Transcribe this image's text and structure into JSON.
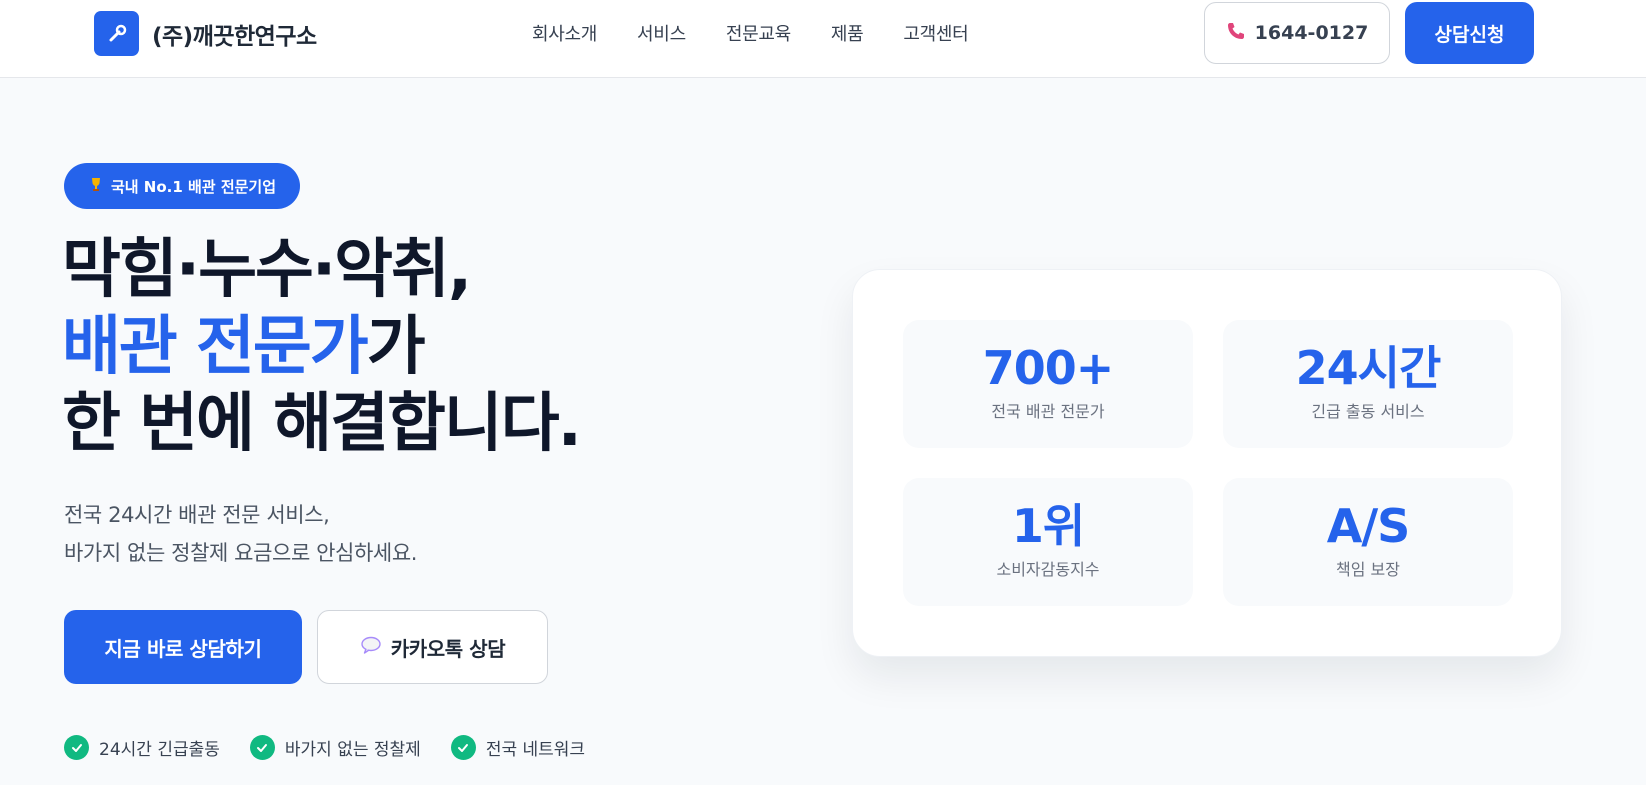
{
  "header": {
    "logo_text": "(주)깨끗한연구소",
    "nav": [
      "회사소개",
      "서비스",
      "전문교육",
      "제품",
      "고객센터"
    ],
    "phone": "1644-0127",
    "consult_label": "상담신청"
  },
  "hero": {
    "badge": "국내 No.1 배관 전문기업",
    "headline_line1": "막힘·누수·악취,",
    "headline_accent": "배관 전문가",
    "headline_line2_rest": "가",
    "headline_line3": "한 번에 해결합니다.",
    "sub_line1": "전국 24시간 배관 전문 서비스,",
    "sub_line2": "바가지 없는 정찰제 요금으로 안심하세요.",
    "cta_primary": "지금 바로 상담하기",
    "cta_secondary": "카카오톡 상담",
    "features": [
      "24시간 긴급출동",
      "바가지 없는 정찰제",
      "전국 네트워크"
    ]
  },
  "stats": [
    {
      "value": "700+",
      "label": "전국 배관 전문가"
    },
    {
      "value": "24시간",
      "label": "긴급 출동 서비스"
    },
    {
      "value": "1위",
      "label": "소비자감동지수"
    },
    {
      "value": "A/S",
      "label": "책임 보장"
    }
  ],
  "colors": {
    "accent": "#2563eb",
    "check": "#10b981",
    "heading": "#0f172a"
  },
  "icons": {
    "logo": "wrench-icon",
    "phone": "phone-icon",
    "badge": "trophy-icon",
    "kakao": "speech-bubble-icon",
    "feature": "check-icon"
  }
}
